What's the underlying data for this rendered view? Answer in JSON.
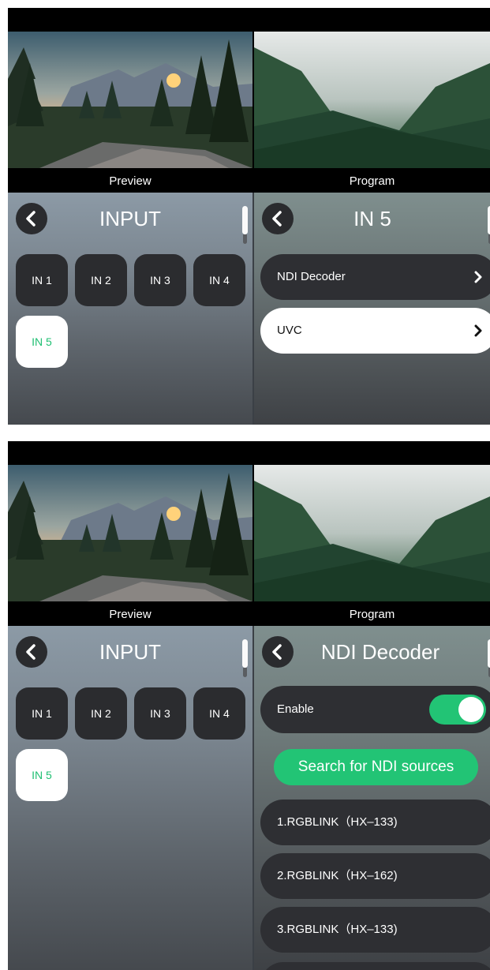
{
  "screen1": {
    "preview_label": "Preview",
    "program_label": "Program",
    "left_panel": {
      "title": "INPUT",
      "inputs": [
        "IN 1",
        "IN 2",
        "IN 3",
        "IN 4",
        "IN 5"
      ],
      "selected": "IN 5"
    },
    "right_panel": {
      "title": "IN 5",
      "items": [
        {
          "label": "NDI Decoder",
          "highlighted": false
        },
        {
          "label": "UVC",
          "highlighted": true
        }
      ]
    }
  },
  "screen2": {
    "preview_label": "Preview",
    "program_label": "Program",
    "left_panel": {
      "title": "INPUT",
      "inputs": [
        "IN 1",
        "IN 2",
        "IN 3",
        "IN 4",
        "IN 5"
      ],
      "selected": "IN 5"
    },
    "right_panel": {
      "title": "NDI Decoder",
      "enable_label": "Enable",
      "enable_on": true,
      "search_label": "Search for NDI sources",
      "sources": [
        "1.RGBLINK（HX–133)",
        "2.RGBLINK（HX–162)",
        "3.RGBLINK（HX–133)"
      ]
    }
  },
  "colors": {
    "accent_green": "#22c475",
    "selected_text_green": "#1fbf72",
    "button_dark": "#2b2c2f"
  },
  "icons": {
    "back": "chevron-left-icon",
    "item_arrow": "chevron-right-icon"
  }
}
